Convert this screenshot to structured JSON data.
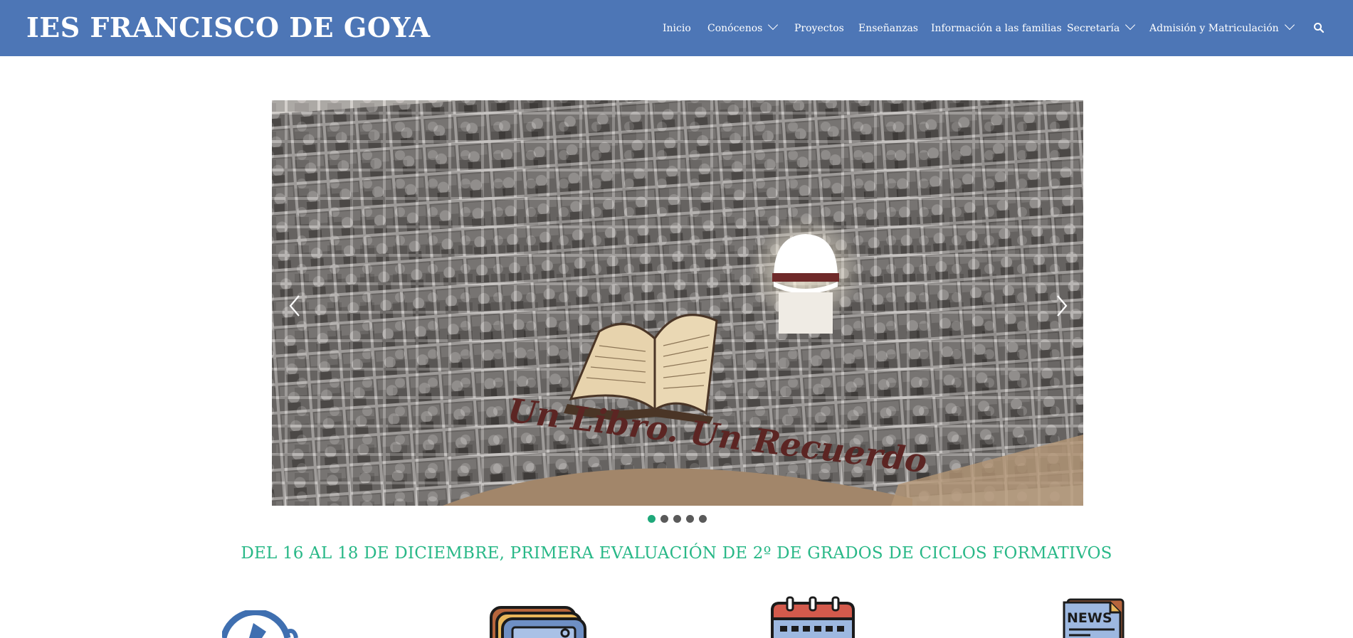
{
  "site": {
    "logo_text": "IES FRANCISCO DE GOYA"
  },
  "nav": {
    "items": [
      {
        "label": "Inicio",
        "has_dropdown": false
      },
      {
        "label": "Conócenos",
        "has_dropdown": true
      },
      {
        "label": "Proyectos",
        "has_dropdown": false
      },
      {
        "label": "Enseñanzas",
        "has_dropdown": false
      },
      {
        "label": "Información a las familias",
        "has_dropdown": false
      },
      {
        "label": "Secretaría",
        "has_dropdown": true
      },
      {
        "label": "Admisión y Matriculación",
        "has_dropdown": true
      }
    ],
    "search_icon": "search-icon"
  },
  "slider": {
    "caption": "Un Libro. Un Recuerdo",
    "slide_count": 5,
    "active_index": 0,
    "prev_icon": "chevron-left-icon",
    "next_icon": "chevron-right-icon"
  },
  "announcement": {
    "text": "DEL 16 AL 18 DE DICIEMBRE, PRIMERA EVALUACIÓN DE 2º DE GRADOS DE CICLOS FORMATIVOS"
  },
  "features": {
    "icons": [
      "music-note-icon",
      "tablet-screen-icon",
      "calendar-icon",
      "news-icon"
    ],
    "news_icon_label": "NEWS"
  },
  "colors": {
    "header_bg": "#4d76b6",
    "accent_green": "#28b887",
    "dot_active": "#1fa87a",
    "dot_inactive": "#5a5a5a"
  }
}
